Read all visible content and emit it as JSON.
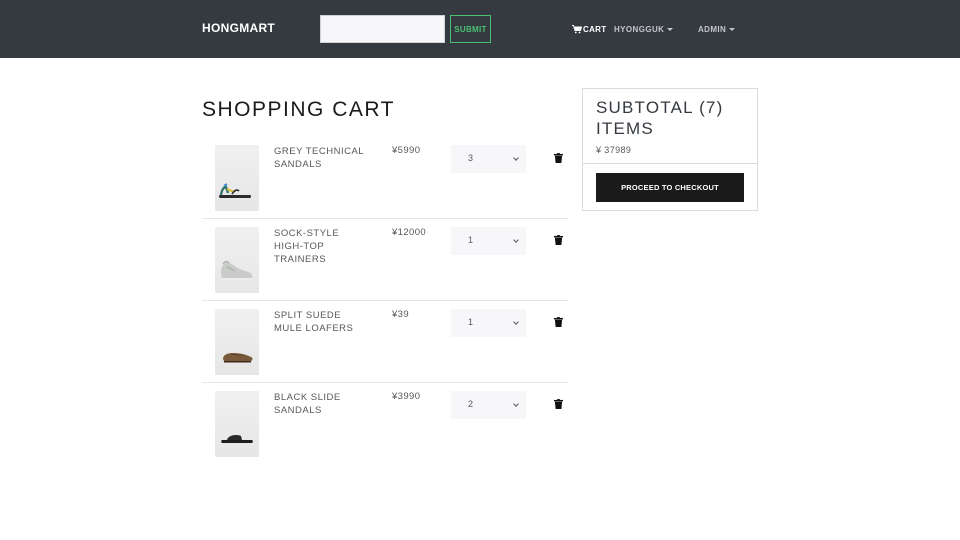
{
  "navbar": {
    "brand": "HONGMART",
    "search_value": "",
    "search_placeholder": "",
    "submit_label": "SUBMIT",
    "cart_label": "CART",
    "user_label": "HYONGGUK",
    "admin_label": "ADMIN"
  },
  "page": {
    "title": "SHOPPING CART"
  },
  "cart": {
    "items": [
      {
        "name": "GREY TECHNICAL SANDALS",
        "price": "¥5990",
        "qty": "3",
        "image_icon": "sandal-product-image"
      },
      {
        "name": "SOCK-STYLE HIGH-TOP TRAINERS",
        "price": "¥12000",
        "qty": "1",
        "image_icon": "trainer-product-image"
      },
      {
        "name": "SPLIT SUEDE MULE LOAFERS",
        "price": "¥39",
        "qty": "1",
        "image_icon": "loafer-product-image"
      },
      {
        "name": "BLACK SLIDE SANDALS",
        "price": "¥3990",
        "qty": "2",
        "image_icon": "slide-product-image"
      }
    ]
  },
  "summary": {
    "title": "SUBTOTAL (7) ITEMS",
    "amount": "¥ 37989",
    "checkout_label": "PROCEED TO CHECKOUT"
  },
  "colors": {
    "navbar": "#343a40",
    "accent_green": "#4bbf73",
    "checkout": "#1a1a1a",
    "select_bg": "#f7f7f9"
  }
}
